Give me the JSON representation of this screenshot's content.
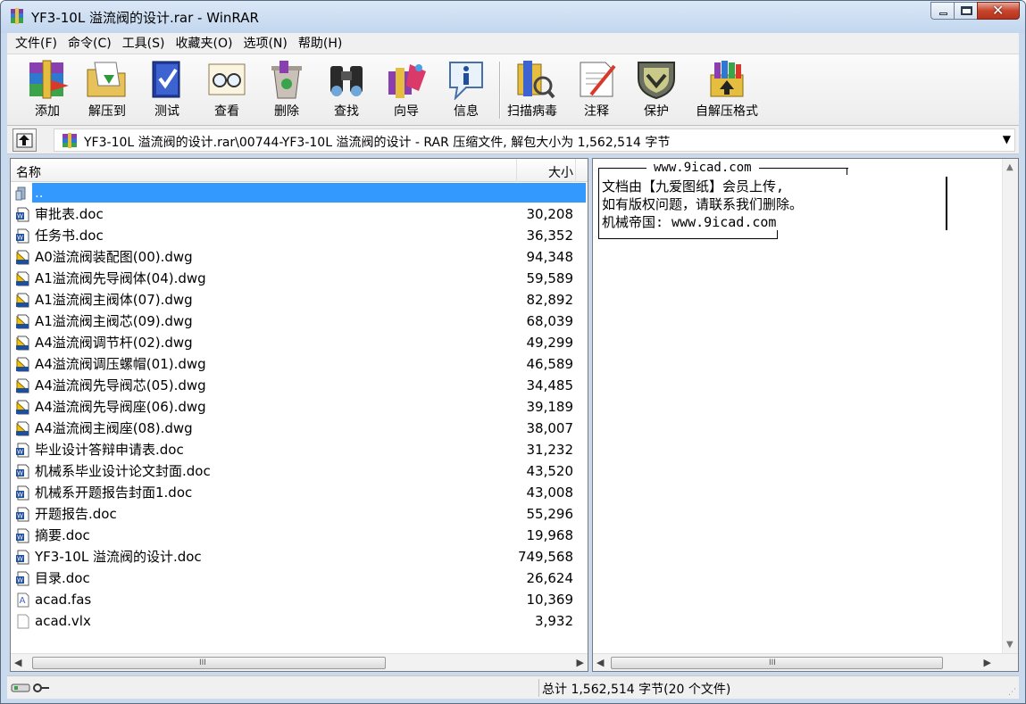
{
  "window": {
    "title": "YF3-10L 溢流阀的设计.rar - WinRAR",
    "close_glyph": "✕"
  },
  "menu": [
    "文件(F)",
    "命令(C)",
    "工具(S)",
    "收藏夹(O)",
    "选项(N)",
    "帮助(H)"
  ],
  "toolbar": {
    "add": "添加",
    "extract": "解压到",
    "test": "测试",
    "view": "查看",
    "delete": "删除",
    "find": "查找",
    "wizard": "向导",
    "info": "信息",
    "scan": "扫描病毒",
    "comment": "注释",
    "protect": "保护",
    "sfx": "自解压格式"
  },
  "address": {
    "path": "YF3-10L 溢流阀的设计.rar\\00744-YF3-10L 溢流阀的设计 - RAR 压缩文件, 解包大小为 1,562,514 字节",
    "dropdown_glyph": "▼"
  },
  "list": {
    "col_name": "名称",
    "col_size": "大小",
    "rows": [
      {
        "name": "..",
        "size": "",
        "icon": "folder-up-icon"
      },
      {
        "name": "审批表.doc",
        "size": "30,208",
        "icon": "doc-icon"
      },
      {
        "name": "任务书.doc",
        "size": "36,352",
        "icon": "doc-icon"
      },
      {
        "name": "A0溢流阀装配图(00).dwg",
        "size": "94,348",
        "icon": "dwg-icon"
      },
      {
        "name": "A1溢流阀先导阀体(04).dwg",
        "size": "59,589",
        "icon": "dwg-icon"
      },
      {
        "name": "A1溢流阀主阀体(07).dwg",
        "size": "82,892",
        "icon": "dwg-icon"
      },
      {
        "name": "A1溢流阀主阀芯(09).dwg",
        "size": "68,039",
        "icon": "dwg-icon"
      },
      {
        "name": "A4溢流阀调节杆(02).dwg",
        "size": "49,299",
        "icon": "dwg-icon"
      },
      {
        "name": "A4溢流阀调压螺帽(01).dwg",
        "size": "46,589",
        "icon": "dwg-icon"
      },
      {
        "name": "A4溢流阀先导阀芯(05).dwg",
        "size": "34,485",
        "icon": "dwg-icon"
      },
      {
        "name": "A4溢流阀先导阀座(06).dwg",
        "size": "39,189",
        "icon": "dwg-icon"
      },
      {
        "name": "A4溢流阀主阀座(08).dwg",
        "size": "38,007",
        "icon": "dwg-icon"
      },
      {
        "name": "毕业设计答辩申请表.doc",
        "size": "31,232",
        "icon": "doc-icon"
      },
      {
        "name": "机械系毕业设计论文封面.doc",
        "size": "43,520",
        "icon": "doc-icon"
      },
      {
        "name": "机械系开题报告封面1.doc",
        "size": "43,008",
        "icon": "doc-icon"
      },
      {
        "name": "开题报告.doc",
        "size": "55,296",
        "icon": "doc-icon"
      },
      {
        "name": "摘要.doc",
        "size": "19,968",
        "icon": "doc-icon"
      },
      {
        "name": "YF3-10L 溢流阀的设计.doc",
        "size": "749,568",
        "icon": "doc-icon"
      },
      {
        "name": "目录.doc",
        "size": "26,624",
        "icon": "doc-icon"
      },
      {
        "name": "acad.fas",
        "size": "10,369",
        "icon": "fas-file-icon"
      },
      {
        "name": "acad.vlx",
        "size": "3,932",
        "icon": "blank-file-icon"
      }
    ],
    "selected_index": 0
  },
  "comment": {
    "url_top": "www.9icad.com",
    "line1": "文档由【九爱图纸】会员上传,",
    "line2": "如有版权问题，请联系我们删除。",
    "line3": "机械帝国: www.9icad.com"
  },
  "scroll": {
    "left": "◀",
    "right": "▶",
    "up": "▲",
    "down": "▼",
    "grip": "III"
  },
  "status": {
    "summary": "总计 1,562,514 字节(20 个文件)"
  },
  "colors": {
    "selection": "#3399ff",
    "doc_blue": "#1f4f9c",
    "dwg_yellow": "#f2c400"
  }
}
